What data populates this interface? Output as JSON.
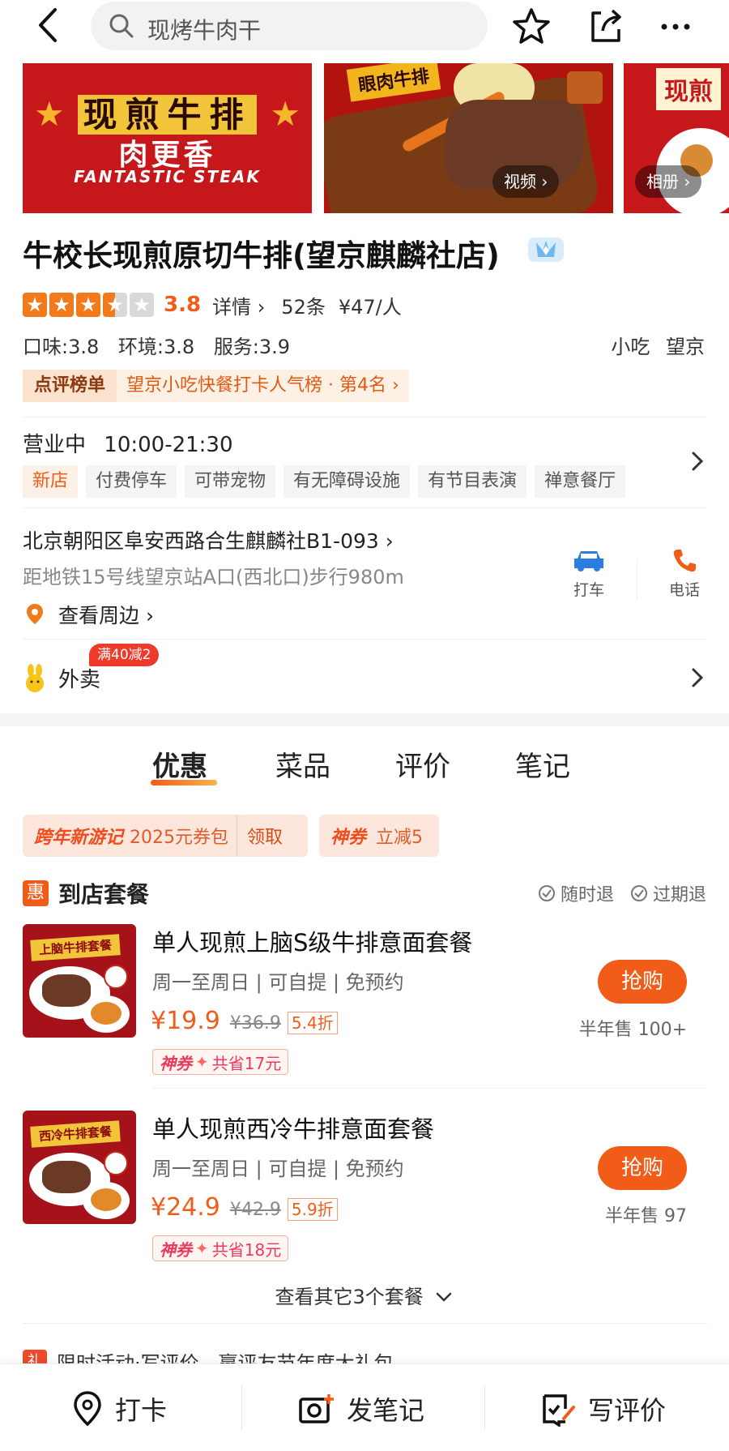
{
  "topbar": {
    "search_placeholder": "现烤牛肉干"
  },
  "photos": {
    "photo1": {
      "line1": "现煎牛排",
      "line2": "肉更香",
      "line3": "FANTASTIC STEAK"
    },
    "photo2": {
      "banner": "眼肉牛排"
    },
    "photo3": {
      "banner": "现煎"
    },
    "video_label": "视频 ›",
    "album_label": "相册 ›"
  },
  "shop": {
    "name": "牛校长现煎原切牛排(望京麒麟社店)",
    "rating": 3.5,
    "score": "3.8",
    "detail_label": "详情 ›",
    "review_count": "52条",
    "avg_price": "¥47/人",
    "sub_scores": [
      "口味:3.8",
      "环境:3.8",
      "服务:3.9"
    ],
    "categories": [
      "小吃",
      "望京"
    ],
    "rank_tag": "点评榜单",
    "rank_text": "望京小吃快餐打卡人气榜 · 第4名 ›",
    "status": "营业中",
    "hours": "10:00-21:30",
    "facilities": [
      "新店",
      "付费停车",
      "可带宠物",
      "有无障碍设施",
      "有节目表演",
      "禅意餐厅"
    ],
    "address": "北京朝阳区阜安西路合生麒麟社B1-093 ›",
    "metro": "距地铁15号线望京站A口(西北口)步行980m",
    "nearby": "查看周边 ›",
    "taxi": "打车",
    "phone": "电话",
    "waimai": "外卖",
    "waimai_promo": "满40减2"
  },
  "tabs": [
    "优惠",
    "菜品",
    "评价",
    "笔记"
  ],
  "coupons": {
    "c1_name": "跨年新游记",
    "c1_value": "2025元券包",
    "c1_btn": "领取",
    "c2_name": "神券",
    "c2_value": "立减5"
  },
  "section": {
    "icon": "惠",
    "title": "到店套餐",
    "refund1": "随时退",
    "refund2": "过期退"
  },
  "deals": [
    {
      "img_banner": "上脑牛排套餐",
      "name": "单人现煎上脑S级牛排意面套餐",
      "meta": "周一至周日 | 可自提 | 免预约",
      "price": "¥19.9",
      "orig": "¥36.9",
      "discount": "5.4折",
      "coupon_tag": "神券",
      "save": "共省17元",
      "buy": "抢购",
      "sold": "半年售 100+"
    },
    {
      "img_banner": "西冷牛排套餐",
      "name": "单人现煎西冷牛排意面套餐",
      "meta": "周一至周日 | 可自提 | 免预约",
      "price": "¥24.9",
      "orig": "¥42.9",
      "discount": "5.9折",
      "coupon_tag": "神券",
      "save": "共省18元",
      "buy": "抢购",
      "sold": "半年售 97"
    }
  ],
  "more_deals": "查看其它3个套餐",
  "activity": {
    "tag": "礼",
    "text": "限时活动·写评价，赢评友节年度大礼包"
  },
  "bottom": {
    "checkin": "打卡",
    "note": "发笔记",
    "review": "写评价"
  },
  "colors": {
    "accent": "#f25c19",
    "star_on": "#f27a1a",
    "star_off": "#d9d9d9"
  }
}
